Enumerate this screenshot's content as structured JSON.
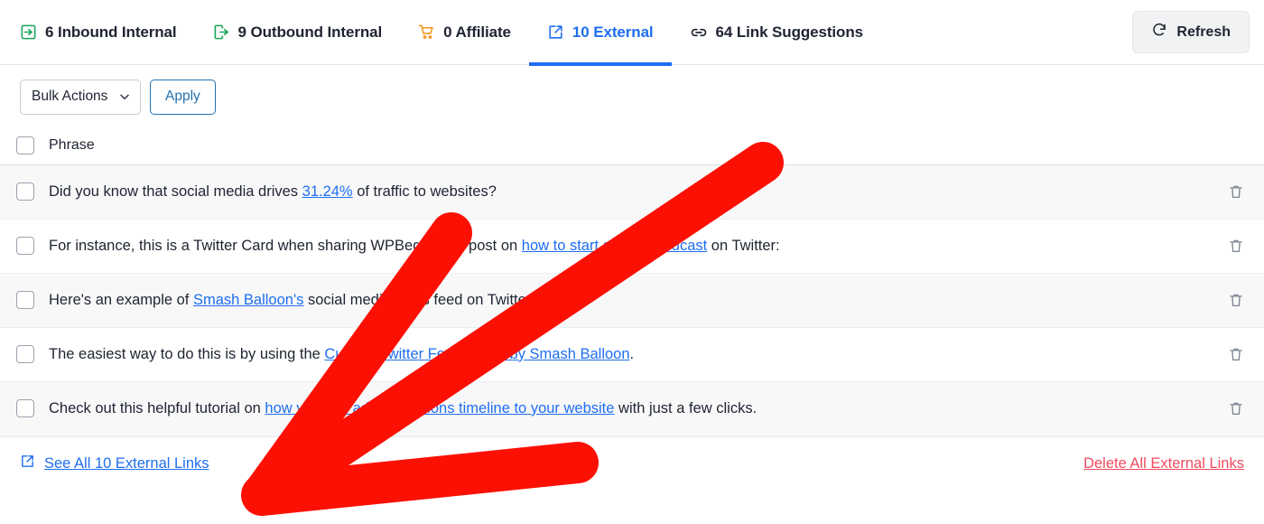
{
  "tabs": [
    {
      "id": "inbound-internal",
      "count": "6",
      "label": "6 Inbound Internal",
      "icon": "arrow-into-box-icon",
      "active": false,
      "color": "#18a558"
    },
    {
      "id": "outbound-internal",
      "count": "9",
      "label": "9 Outbound Internal",
      "icon": "arrow-out-of-box-icon",
      "active": false,
      "color": "#18a558"
    },
    {
      "id": "affiliate",
      "count": "0",
      "label": "0 Affiliate",
      "icon": "shopping-cart-icon",
      "active": false,
      "color": "#f7941d"
    },
    {
      "id": "external",
      "count": "10",
      "label": "10 External",
      "icon": "external-link-icon",
      "active": true,
      "color": "#1e6ef0"
    },
    {
      "id": "link-suggestions",
      "count": "64",
      "label": "64 Link Suggestions",
      "icon": "chain-link-icon",
      "active": false,
      "color": "#1e2431"
    }
  ],
  "header": {
    "refresh_label": "Refresh",
    "refresh_icon": "refresh-icon"
  },
  "toolbar": {
    "bulk_actions_value": "Bulk Actions",
    "bulk_actions_options": [
      "Bulk Actions"
    ],
    "apply_label": "Apply"
  },
  "table": {
    "column_header": "Phrase",
    "rows": [
      {
        "parts": [
          {
            "text": "Did you know that social media drives "
          },
          {
            "text": "31.24%",
            "link": true
          },
          {
            "text": " of traffic to websites?"
          }
        ],
        "delete_icon": "trash-icon"
      },
      {
        "parts": [
          {
            "text": "For instance, this is a Twitter Card when sharing WPBeginner's post on "
          },
          {
            "text": "how to start a video podcast",
            "link": true
          },
          {
            "text": " on Twitter:"
          }
        ],
        "delete_icon": "trash-icon"
      },
      {
        "parts": [
          {
            "text": "Here's an example of "
          },
          {
            "text": "Smash Balloon's",
            "link": true
          },
          {
            "text": " social media news feed on Twitter:"
          }
        ],
        "delete_icon": "trash-icon"
      },
      {
        "parts": [
          {
            "text": "The easiest way to do this is by using the "
          },
          {
            "text": "Custom Twitter Feed plugin by Smash Balloon",
            "link": true
          },
          {
            "text": "."
          }
        ],
        "delete_icon": "trash-icon"
      },
      {
        "parts": [
          {
            "text": "Check out this helpful tutorial on "
          },
          {
            "text": "how you can add a mentions timeline to your website",
            "link": true
          },
          {
            "text": " with just a few clicks."
          }
        ],
        "delete_icon": "trash-icon"
      }
    ]
  },
  "footer": {
    "see_all_label": "See All 10 External Links",
    "see_all_icon": "external-link-icon",
    "delete_all_label": "Delete All External Links"
  },
  "annotation": {
    "shape": "red-arrow-pointing-down-left",
    "color": "#fc1004"
  },
  "colors": {
    "accent_blue": "#1e6ef0",
    "link_blue": "#2271b1",
    "danger_red": "#ef4b5e",
    "green": "#18a558",
    "orange": "#f7941d",
    "annotation_red": "#fc1004",
    "row_stripe": "#f8f8f9"
  }
}
